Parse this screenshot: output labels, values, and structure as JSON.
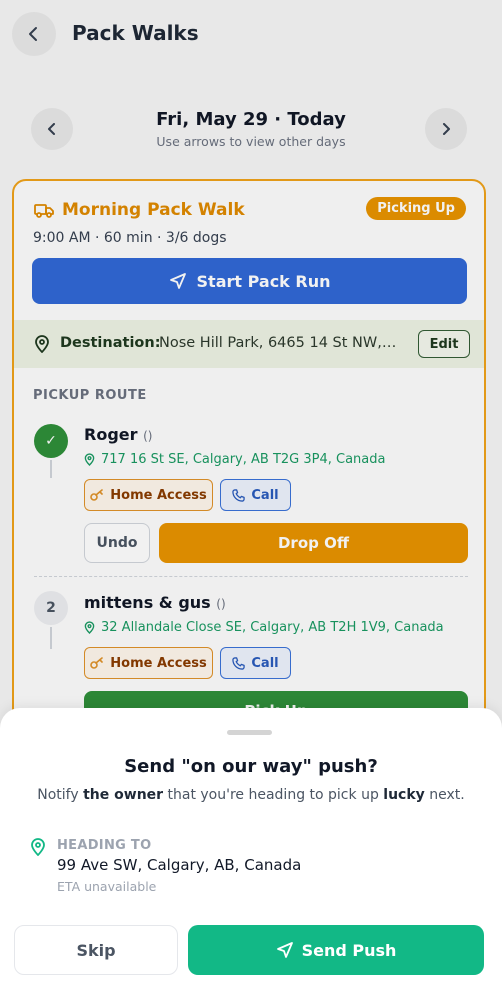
{
  "header": {
    "title": "Pack Walks",
    "back_icon": "chevron-left-icon"
  },
  "date_nav": {
    "date_label": "Fri, May 29 · Today",
    "hint": "Use arrows to view other days",
    "prev_icon": "chevron-left-icon",
    "next_icon": "chevron-right-icon"
  },
  "walk": {
    "title": "Morning Pack Walk",
    "status": "Picking Up",
    "meta": "9:00 AM · 60 min · 3/6 dogs",
    "start_label": "Start Pack Run",
    "destination_label": "Destination:",
    "destination_value": "Nose Hill Park, 6465 14 St NW, C...",
    "edit_label": "Edit",
    "section_title": "PICKUP ROUTE",
    "colors": {
      "accent": "#e08a00",
      "primary": "#3168d6",
      "success": "#2f8f3a"
    }
  },
  "stops": [
    {
      "step": "✓",
      "name": "Roger",
      "name_suffix": "()",
      "address": "717 16 St SE, Calgary, AB T2G 3P4, Canada",
      "home_access_label": "Home Access",
      "call_label": "Call",
      "undo_label": "Undo",
      "action_label": "Drop Off"
    },
    {
      "step": "2",
      "name": "mittens & gus",
      "name_suffix": "()",
      "address": "32 Allandale Close SE, Calgary, AB T2H 1V9, Canada",
      "home_access_label": "Home Access",
      "call_label": "Call",
      "action_label": "Pick Up"
    }
  ],
  "sheet": {
    "title": "Send \"on our way\" push?",
    "subtitle_parts": [
      "Notify ",
      "the owner",
      " that you're heading to pick up ",
      "lucky",
      " next."
    ],
    "heading_label": "HEADING TO",
    "heading_address": "99 Ave SW, Calgary, AB, Canada",
    "eta": "ETA unavailable",
    "skip_label": "Skip",
    "send_label": "Send Push",
    "send_color": "#12b886"
  }
}
